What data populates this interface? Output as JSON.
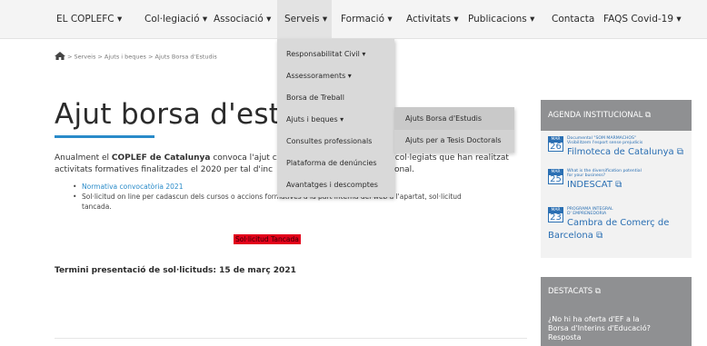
{
  "nav": {
    "items": [
      {
        "label": "EL COPLEFC ▾"
      },
      {
        "label": "Col·legiació ▾"
      },
      {
        "label": "Associació ▾"
      },
      {
        "label": "Serveis ▾"
      },
      {
        "label": "Formació ▾"
      },
      {
        "label": "Activitats ▾"
      },
      {
        "label": "Publicacions ▾"
      },
      {
        "label": "Contacta"
      },
      {
        "label": "FAQS Covid-19 ▾"
      }
    ]
  },
  "dropdown": {
    "items": [
      {
        "label": "Responsabilitat Civil ▾"
      },
      {
        "label": "Assessoraments ▾"
      },
      {
        "label": "Borsa de Treball"
      },
      {
        "label": "Ajuts i beques ▾"
      },
      {
        "label": "Consultes professionals"
      },
      {
        "label": "Plataforma de denúncies"
      },
      {
        "label": "Avantatges i descomptes"
      }
    ],
    "submenu": [
      {
        "label": "Ajuts Borsa d'Estudis"
      },
      {
        "label": "Ajuts per a Tesis Doctorals"
      }
    ]
  },
  "breadcrumb": {
    "text": "> Serveis > Ajuts i beques > Ajuts Borsa d'Estudis"
  },
  "main": {
    "title": "Ajut borsa d'estuc",
    "intro_line1_a": "Anualment el ",
    "intro_line1_b": "COPLEF de Catalunya",
    "intro_line1_c": " convoca l'ajut c",
    "intro_line1_d": "ls col·legiats que han realitzat",
    "intro_line2_a": "activitats formatives finalitzades el 2020 per tal d'inc",
    "intro_line2_b": "ssional.",
    "bullet1": "Normativa convocatòria 2021",
    "bullet2": "Sol·licitud on line per cadascun dels cursos o accions formatives a la part interna del web a l'apartat, sol·licitud tancada.",
    "closed_badge": "Sol·licitud Tancada",
    "deadline": "Termini presentació de sol·licituds: 15 de març 2021"
  },
  "sidebar": {
    "agenda_title": "AGENDA INSTITUCIONAL ⧉",
    "events": [
      {
        "month": "MAR",
        "day": "26",
        "small": "Documental \"SOM MARMACHOS\"\nVisibilitzem l'esport sense prejudicis",
        "big": "Filmoteca de Catalunya ⧉"
      },
      {
        "month": "MAR",
        "day": "25",
        "small": "What is the diversification potential\nfor your business?",
        "big": "INDESCAT ⧉"
      },
      {
        "month": "MAR",
        "day": "23",
        "small": "PROGRAMA INTEGRAL\nD' EMPRENEDORIA",
        "big": "Cambra de Comerç de",
        "big2": "Barcelona ⧉"
      }
    ],
    "destacats_title": "DESTACATS ⧉",
    "destacats_text": "¿No hi ha oferta d'EF a la Borsa d'Interins d'Educació? Resposta"
  },
  "colors": {
    "accent": "#2a8bc9",
    "badge_red": "#e3001b",
    "sidebar_grey": "#8f9092",
    "event_blue": "#2a6fb3"
  }
}
